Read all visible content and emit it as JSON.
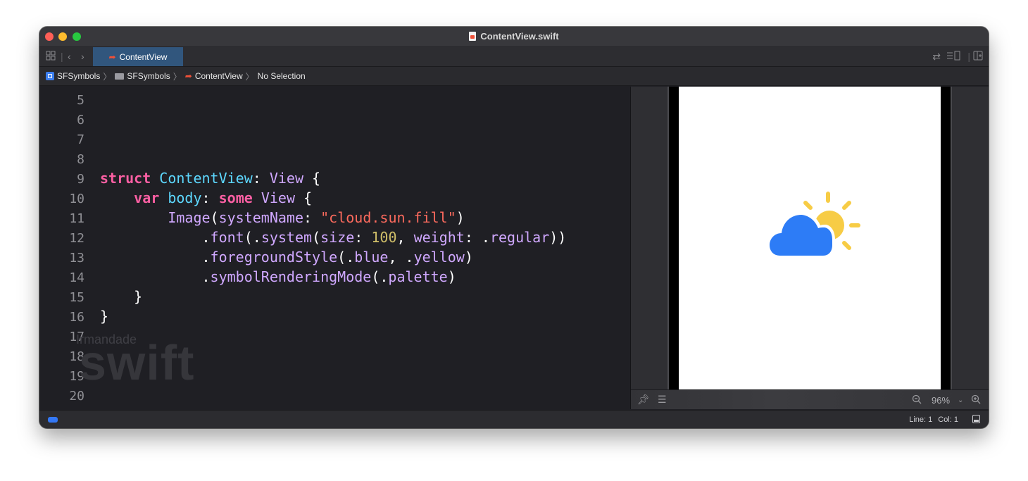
{
  "window": {
    "title": "ContentView.swift"
  },
  "tabbar": {
    "active_tab": "ContentView"
  },
  "breadcrumb": {
    "items": [
      "SFSymbols",
      "SFSymbols",
      "ContentView",
      "No Selection"
    ]
  },
  "editor": {
    "line_numbers": [
      "5",
      "6",
      "7",
      "8",
      "9",
      "10",
      "11",
      "12",
      "13",
      "14",
      "15",
      "16",
      "17",
      "18",
      "19",
      "20"
    ],
    "code": {
      "l9": [
        "struct",
        " ",
        "ContentView",
        ": ",
        "View",
        " {"
      ],
      "l10": [
        "    ",
        "var",
        " ",
        "body",
        ": ",
        "some",
        " ",
        "View",
        " {"
      ],
      "l11": [
        "        ",
        "Image",
        "(",
        "systemName",
        ": ",
        "\"cloud.sun.fill\"",
        ")"
      ],
      "l12": [
        "            .",
        "font",
        "(.",
        "system",
        "(",
        "size",
        ": ",
        "100",
        ", ",
        "weight",
        ": .",
        "regular",
        "))"
      ],
      "l13": [
        "            .",
        "foregroundStyle",
        "(.",
        "blue",
        ", .",
        "yellow",
        ")"
      ],
      "l14": [
        "            .",
        "symbolRenderingMode",
        "(.",
        "palette",
        ")"
      ],
      "l15": [
        "    }"
      ],
      "l16": [
        "}"
      ]
    },
    "watermark": {
      "small": "Irmandade",
      "large": "swift"
    }
  },
  "preview": {
    "zoom": "96%",
    "symbol_colors": {
      "cloud": "#2d7cf6",
      "sun": "#f7cc45"
    }
  },
  "statusbar": {
    "line": "Line: 1",
    "col": "Col: 1"
  },
  "colors": {
    "keyword": "#fc5fa3",
    "type": "#5dd8ff",
    "call": "#d0a8ff",
    "string": "#fc6a5d",
    "number": "#d0bf69",
    "tab_active": "#31567d",
    "accent": "#3478f6"
  }
}
